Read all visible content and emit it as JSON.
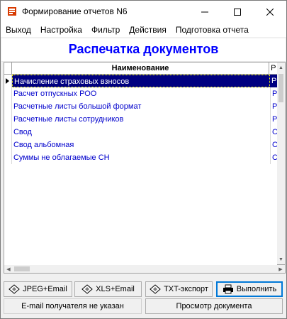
{
  "window": {
    "title": "Формирование отчетов N6"
  },
  "menu": [
    "Выход",
    "Настройка",
    "Фильтр",
    "Действия",
    "Подготовка отчета"
  ],
  "heading": "Распечатка документов",
  "grid": {
    "columns": [
      "Наименование",
      "Р"
    ],
    "rows": [
      {
        "name": "Начисление страховых взносов",
        "code": "Р",
        "selected": true
      },
      {
        "name": "Расчет отпускных РОО",
        "code": "Р",
        "selected": false
      },
      {
        "name": "Расчетные листы большой формат",
        "code": "Р",
        "selected": false
      },
      {
        "name": "Расчетные листы сотрудников",
        "code": "Р",
        "selected": false
      },
      {
        "name": "Свод",
        "code": "С",
        "selected": false
      },
      {
        "name": "Свод альбомная",
        "code": "С",
        "selected": false
      },
      {
        "name": "Суммы не облагаемые СН",
        "code": "С",
        "selected": false
      }
    ]
  },
  "buttons": {
    "jpeg_email": "JPEG+Email",
    "xls_email": "XLS+Email",
    "txt_export": "TXT-экспорт",
    "execute": "Выполнить",
    "preview": "Просмотр документа"
  },
  "status": {
    "email_recipient": "E-mail получателя не указан"
  },
  "colors": {
    "heading": "#0000ff",
    "row_text": "#0000cc",
    "selected_bg": "#000080",
    "focus": "#0078d7"
  },
  "icons": {
    "app": "report-app-icon",
    "export": "diamond-export-icon",
    "execute": "printer-icon"
  }
}
